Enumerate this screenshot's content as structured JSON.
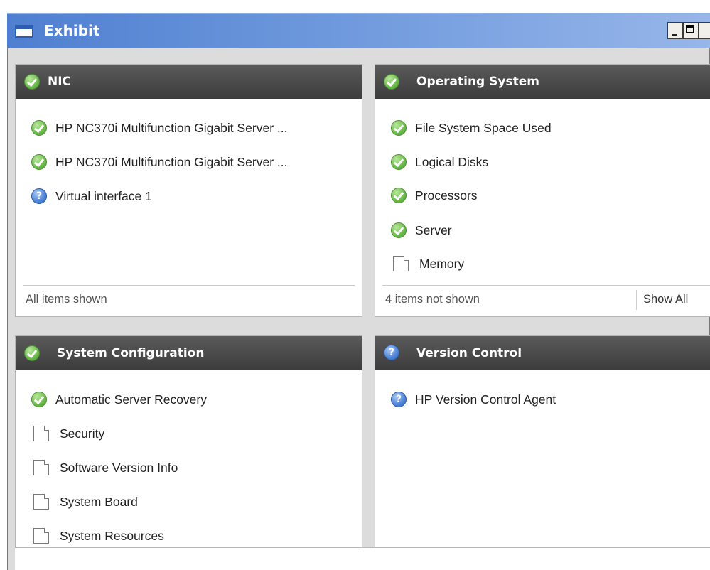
{
  "window": {
    "title": "Exhibit"
  },
  "panels": {
    "nic": {
      "title": "NIC",
      "items": [
        {
          "label": "HP NC370i Multifunction Gigabit Server ...",
          "status": "ok"
        },
        {
          "label": "HP NC370i Multifunction Gigabit Server ...",
          "status": "ok"
        },
        {
          "label": "Virtual interface 1",
          "status": "unknown"
        }
      ],
      "footer": "All items shown"
    },
    "os": {
      "title": "Operating System",
      "items": [
        {
          "label": "File System Space Used",
          "status": "ok"
        },
        {
          "label": "Logical Disks",
          "status": "ok"
        },
        {
          "label": "Processors",
          "status": "ok"
        },
        {
          "label": "Server",
          "status": "ok"
        },
        {
          "label": "Memory",
          "status": "none"
        }
      ],
      "footer": "4 items not shown",
      "show_all": "Show All"
    },
    "syscfg": {
      "title": "System Configuration",
      "items": [
        {
          "label": "Automatic Server Recovery",
          "status": "ok"
        },
        {
          "label": "Security",
          "status": "none"
        },
        {
          "label": "Software Version Info",
          "status": "none"
        },
        {
          "label": "System Board",
          "status": "none"
        },
        {
          "label": "System Resources",
          "status": "none"
        }
      ]
    },
    "vc": {
      "title": "Version Control",
      "items": [
        {
          "label": "HP Version Control Agent",
          "status": "unknown"
        }
      ]
    }
  },
  "colors": {
    "ok": "#6cbb4c",
    "unknown": "#4f84d8",
    "header": "#4a4a4a",
    "titlebar": "#6d98dc"
  }
}
